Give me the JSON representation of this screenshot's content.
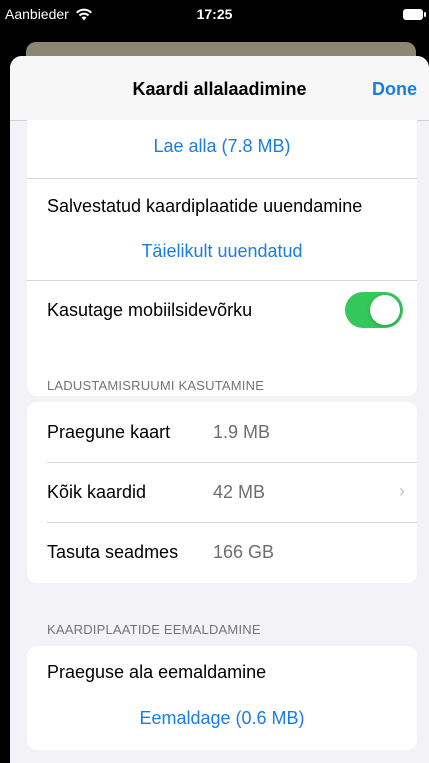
{
  "status_bar": {
    "carrier": "Aanbieder",
    "time": "17:25"
  },
  "nav": {
    "title": "Kaardi allalaadimine",
    "done_label": "Done"
  },
  "download": {
    "download_label": "Lae alla (7.8 MB)"
  },
  "update": {
    "label": "Salvestatud kaardiplaatide uuendamine",
    "status": "Täielikult uuendatud"
  },
  "mobile_data": {
    "label": "Kasutage mobiilsidevõrku",
    "enabled": true
  },
  "storage": {
    "header": "LADUSTAMISRUUMI KASUTAMINE",
    "rows": [
      {
        "label": "Praegune kaart",
        "value": "1.9 MB"
      },
      {
        "label": "Kõik kaardid",
        "value": "42 MB"
      },
      {
        "label": "Tasuta seadmes",
        "value": "166 GB"
      }
    ]
  },
  "removal": {
    "header": "KAARDIPLAATIDE EEMALDAMINE",
    "label": "Praeguse ala eemaldamine",
    "action_label": "Eemaldage (0.6 MB)"
  },
  "colors": {
    "accent": "#1a7de2",
    "toggle_on": "#34c759",
    "background": "#f2f2f7"
  }
}
